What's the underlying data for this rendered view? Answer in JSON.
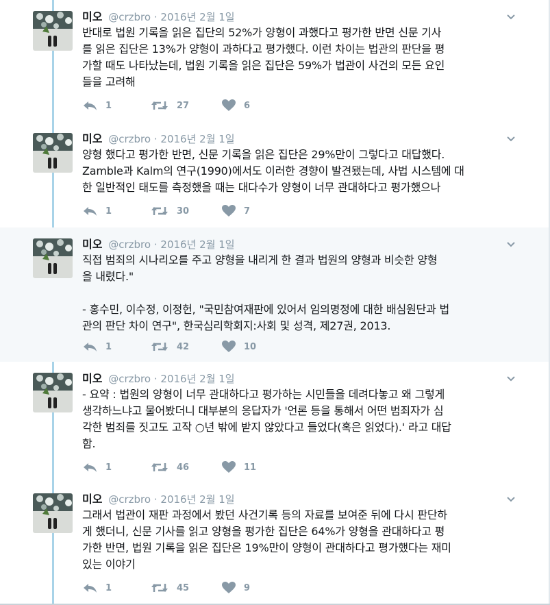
{
  "tweets": [
    {
      "name": "미오",
      "handle": "@crzbro",
      "separator": "·",
      "date": "2016년 2월 1일",
      "text": "반대로 법원 기록을 읽은 집단의 52%가 양형이 과했다고 평가한 반면 신문 기사\n를 읽은 집단은 13%가 양형이 과하다고 평가했다. 이런 차이는 법관의 판단을 평\n가할 때도 나타났는데, 법원 기록을 읽은 집단은 59%가 법관이 사건의 모든 요인\n들을 고려해",
      "replies": "1",
      "retweets": "27",
      "likes": "6"
    },
    {
      "name": "미오",
      "handle": "@crzbro",
      "separator": "·",
      "date": "2016년 2월 1일",
      "text": "양형 했다고 평가한 반면, 신문 기록을 읽은 집단은 29%만이 그렇다고 대답했다.\nZamble과 Kalm의 연구(1990)에서도 이러한 경향이 발견됐는데, 사법 시스템에 대\n한 일반적인 태도를 측정했을 때는 대다수가 양형이 너무 관대하다고 평가했으나",
      "replies": "1",
      "retweets": "30",
      "likes": "7"
    },
    {
      "name": "미오",
      "handle": "@crzbro",
      "separator": "·",
      "date": "2016년 2월 1일",
      "text": "직접 범죄의 시나리오를 주고 양형을 내리게 한 결과 법원의 양형과 비슷한 양형\n을 내렸다.\"\n\n- 홍수민, 이수정, 이정헌, \"국민참여재판에 있어서 임의명정에 대한 배심원단과 법\n관의 판단 차이 연구\", 한국심리학회지:사회 및 성격, 제27권, 2013.",
      "replies": "1",
      "retweets": "42",
      "likes": "10"
    },
    {
      "name": "미오",
      "handle": "@crzbro",
      "separator": "·",
      "date": "2016년 2월 1일",
      "text": "- 요약 : 법원의 양형이 너무 관대하다고 평가하는 시민들을 데려다놓고 왜 그렇게\n생각하느냐고 물어봤더니 대부분의 응답자가 '언론 등을 통해서 어떤 범죄자가 심\n각한 범죄를 짓고도 고작 ○년 밖에 받지 않았다고 들었다(혹은 읽었다).' 라고 대답\n함.",
      "replies": "1",
      "retweets": "46",
      "likes": "11"
    },
    {
      "name": "미오",
      "handle": "@crzbro",
      "separator": "·",
      "date": "2016년 2월 1일",
      "text": "그래서 법관이 재판 과정에서 봤던 사건기록 등의 자료를 보여준 뒤에 다시 판단하\n게 했더니, 신문 기사를 읽고 양형을 평가한 집단은 64%가 양형을 관대하다고 평\n가한 반면, 법원 기록을 읽은 집단은 19%만이 양형이 관대하다고 평가했다는 재미\n있는 이야기",
      "replies": "1",
      "retweets": "45",
      "likes": "9"
    }
  ],
  "icons": {
    "reply": "reply-icon",
    "retweet": "retweet-icon",
    "like": "heart-icon",
    "caret": "chevron-down-icon"
  },
  "colors": {
    "thread_line": "#a8d3e8",
    "meta_gray": "#8899a6",
    "highlight_bg": "#f5f8fa"
  }
}
